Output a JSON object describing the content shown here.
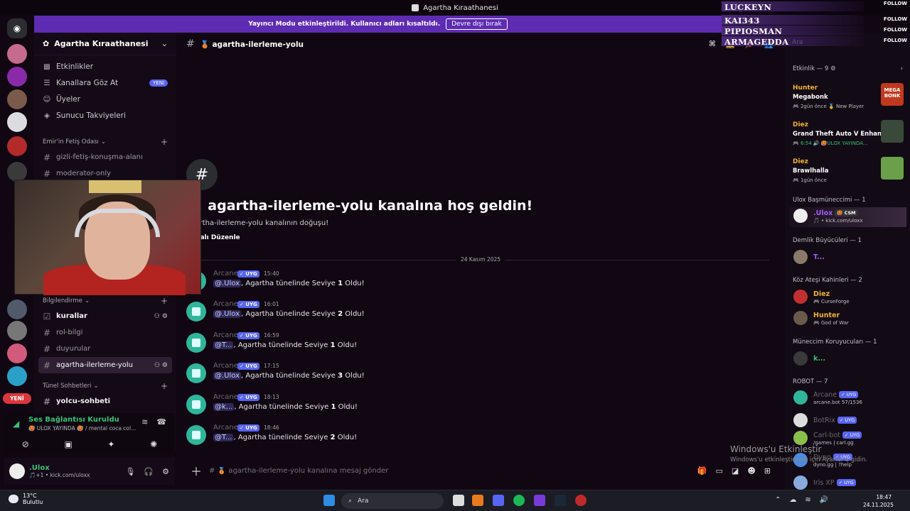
{
  "window": {
    "title": "Agartha Kıraathanesi"
  },
  "banner": {
    "text": "Yayıncı Modu etkinleştirildi. Kullanıcı adları kısaltıldı.",
    "button": "Devre dışı bırak"
  },
  "server": {
    "name": "Agartha Kıraathanesi"
  },
  "nav": [
    {
      "icon": "calendar-icon",
      "label": "Etkinlikler"
    },
    {
      "icon": "browse-icon",
      "label": "Kanallara Göz At",
      "badge": "YENİ"
    },
    {
      "icon": "members-icon",
      "label": "Üyeler"
    },
    {
      "icon": "boost-icon",
      "label": "Sunucu Takviyeleri"
    }
  ],
  "categories": {
    "c1": "Emir'in Fetiş Odası",
    "c2": "Bilgilendirme",
    "c3": "Tünel Sohbetleri"
  },
  "channels": {
    "ch1": "gizli-fetiş-konuşma-alanı",
    "ch2": "moderator-only",
    "ch3": "kurallar",
    "ch4": "rol-bilgi",
    "ch5": "duyurular",
    "ch6": "agartha-ilerleme-yolu",
    "ch7": "yolcu-sohbeti"
  },
  "voice": {
    "title": "Ses Bağlantısı Kuruldu",
    "subtitle": "🥵 ULOX YAYINDA 🥵 / mental coca col..."
  },
  "user": {
    "name": ".Ulox",
    "status": "🎵+1 • kick.com/uloxx"
  },
  "yeni": "YENİ",
  "header": {
    "channel": "🥉 agartha-ilerleme-yolu"
  },
  "welcome": {
    "title": "🥉 agartha-ilerleme-yolu kanalına hoş geldin!",
    "desc": "agartha-ilerleme-yolu kanalının doğuşu!",
    "edit": "Kanalı Düzenle"
  },
  "date_divider": "24 Kasım 2025",
  "messages": [
    {
      "author": "Arcane",
      "tag": "✓ UYG",
      "time": "15:40",
      "mention": "@.Ulox",
      "text": ", Agartha tünelinde Seviye ",
      "level": "1",
      "tail": " Oldu!"
    },
    {
      "author": "Arcane",
      "tag": "✓ UYG",
      "time": "16:01",
      "mention": "@.Ulox",
      "text": ", Agartha tünelinde Seviye ",
      "level": "2",
      "tail": " Oldu!"
    },
    {
      "author": "Arcane",
      "tag": "✓ UYG",
      "time": "16:59",
      "mention": "@T...",
      "text": ", Agartha tünelinde Seviye ",
      "level": "1",
      "tail": " Oldu!"
    },
    {
      "author": "Arcane",
      "tag": "✓ UYG",
      "time": "17:15",
      "mention": "@.Ulox",
      "text": ", Agartha tünelinde Seviye ",
      "level": "3",
      "tail": " Oldu!"
    },
    {
      "author": "Arcane",
      "tag": "✓ UYG",
      "time": "18:13",
      "mention": "@k...",
      "text": ", Agartha tünelinde Seviye ",
      "level": "1",
      "tail": " Oldu!"
    },
    {
      "author": "Arcane",
      "tag": "✓ UYG",
      "time": "18:46",
      "mention": "@T...",
      "text": ", Agartha tünelinde Seviye ",
      "level": "2",
      "tail": " Oldu!"
    }
  ],
  "composer": {
    "placeholder": "# 🥉 agartha-ilerleme-yolu kanalına mesaj gönder"
  },
  "members": {
    "search": "Ara",
    "activity_title": "Etkinlik — 9 ⚙",
    "activities": [
      {
        "name": "Hunter",
        "game": "Megabonk",
        "sub": "🎮 2gün önce  🏅 New Player",
        "art": "MEGA BONK"
      },
      {
        "name": "Diez",
        "game": "Grand Theft Auto V Enhan...",
        "sub": "🎮 6:54  🔊 🥵ULOX YAYINDA..."
      },
      {
        "name": "Diez",
        "game": "Brawlhalla",
        "sub": "🎮 1gün önce"
      }
    ],
    "s1": "Ulox Başmüneccimi — 1",
    "s2": "Demlik Büyücüleri — 1",
    "s3": "Köz Ateşi Kahinleri — 2",
    "s4": "Müneccim Koruyucuları — 1",
    "s5": "ROBOT — 7",
    "m_ulox": {
      "name": ".Ulox",
      "tag": "🥵 CSM",
      "sub": "🎵 • kick.com/uloxx"
    },
    "m_t": {
      "name": "T..."
    },
    "m_diez": {
      "name": "Diez",
      "sub": "🎮 CurseForge"
    },
    "m_hunter": {
      "name": "Hunter",
      "sub": "🎮 God of War"
    },
    "m_k": {
      "name": "k..."
    },
    "bots": [
      {
        "name": "Arcane",
        "tag": "✓ UYG",
        "sub": "arcane.bot 57/1536"
      },
      {
        "name": "BotRix",
        "tag": "✓ UYG",
        "sub": ""
      },
      {
        "name": "Carl-bot",
        "tag": "✓ UYG",
        "sub": "/games | carl.gg"
      },
      {
        "name": "Dyno",
        "tag": "✓ UYG",
        "sub": "dyno.gg | ?help"
      },
      {
        "name": "Iris XP",
        "tag": "✓ UYG",
        "sub": ""
      }
    ]
  },
  "overlay": {
    "names": [
      "LUCKEYN",
      "KAI343",
      "PIPIOSMAN",
      "ARMAGEDDA"
    ],
    "follow": "FOLLOW"
  },
  "watermark": {
    "title": "Windows'u Etkinleştir",
    "sub": "Windows'u etkinleştirmek için Ayarlar'a gidin."
  },
  "taskbar": {
    "temp": "13°C",
    "weather": "Bulutlu",
    "search": "Ara",
    "time": "18:47",
    "date": "24.11.2025"
  }
}
